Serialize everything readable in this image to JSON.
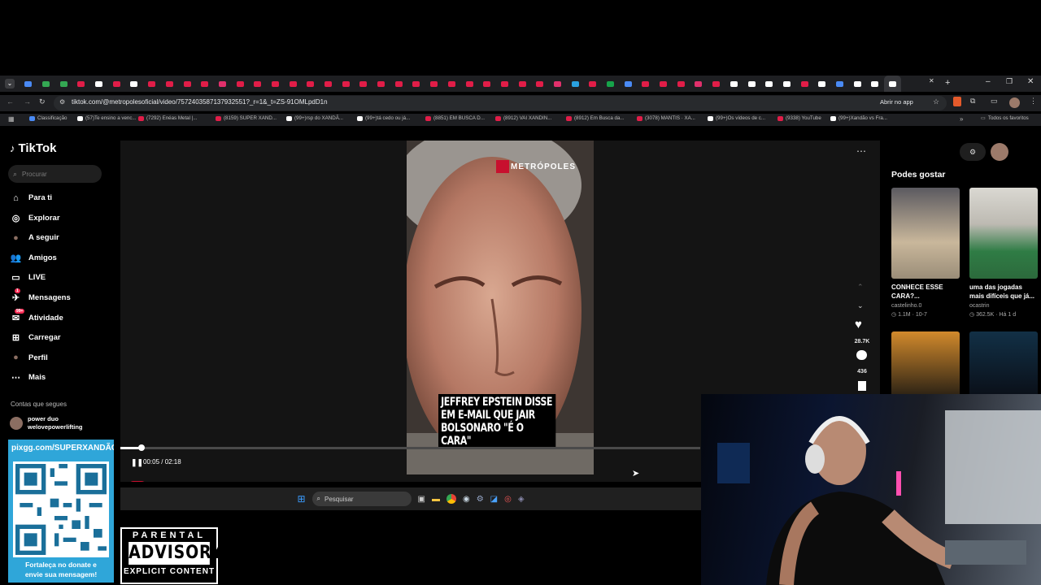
{
  "browser": {
    "url": "tiktok.com/@metropolesoficial/video/7572403587137932551?_r=1&_t=ZS-91OMLpdD1n",
    "open_in_app": "Abrir no app",
    "all_bookmarks": "Todos os favoritos",
    "bookmarks": [
      "Classificação",
      "(57)Te ensino a venc...",
      "(7292) Enéas Metal |...",
      "(8159) SUPER XAND...",
      "(99+)rsp do XANDÃ...",
      "(99+)tá cedo ou já...",
      "(8851) EM BUSCA D...",
      "(8912) VAI XANDIN...",
      "(8912) Em Busca da...",
      "(3078) MANTIS · XA...",
      "(99+)Os vídeos de c...",
      "(9338) YouTube",
      "(99+)Xandão vs Fra..."
    ]
  },
  "tiktok": {
    "logo": "TikTok",
    "search_placeholder": "Procurar",
    "nav": [
      {
        "label": "Para ti",
        "icon": "home-icon"
      },
      {
        "label": "Explorar",
        "icon": "compass-icon"
      },
      {
        "label": "A seguir",
        "icon": "following-icon"
      },
      {
        "label": "Amigos",
        "icon": "friends-icon"
      },
      {
        "label": "LIVE",
        "icon": "live-icon"
      },
      {
        "label": "Mensagens",
        "icon": "messages-icon",
        "badge": "1"
      },
      {
        "label": "Atividade",
        "icon": "activity-icon",
        "badge": "99+"
      },
      {
        "label": "Carregar",
        "icon": "upload-icon"
      },
      {
        "label": "Perfil",
        "icon": "profile-icon"
      },
      {
        "label": "Mais",
        "icon": "more-icon"
      }
    ],
    "following_header": "Contas que segues",
    "following": [
      {
        "name": "power duo",
        "handle": "welovepowerlifting"
      }
    ],
    "video": {
      "brand": "METRÓPOLES",
      "caption": "JEFFREY EPSTEIN DISSE EM E-MAIL QUE JAIR BOLSONARO \"É O CARA\"",
      "time": "00:05 / 02:18",
      "progress": 0.036,
      "author": "metropolesoficial",
      "likes": "28.7K",
      "comments": "436"
    },
    "recs_title": "Podes gostar",
    "recs": [
      {
        "title": "CONHECE ESSE CARA?...",
        "author": "castelinho.0",
        "views": "1.1M",
        "date": "10-7"
      },
      {
        "title": "uma das jogadas mais difíceis que já...",
        "author": "ocastrin",
        "views": "362.5K",
        "date": "Há 1 d"
      }
    ]
  },
  "taskbar": {
    "search_placeholder": "Pesquisar"
  },
  "overlay": {
    "qr_header": "pixgg.com/SUPERXANDÃO",
    "qr_footer_1": "Fortaleça no donate e",
    "qr_footer_2": "envie sua mensagem!",
    "pa_line1": "PARENTAL",
    "pa_line2": "ADVISORY",
    "pa_line3": "EXPLICIT CONTENT"
  }
}
